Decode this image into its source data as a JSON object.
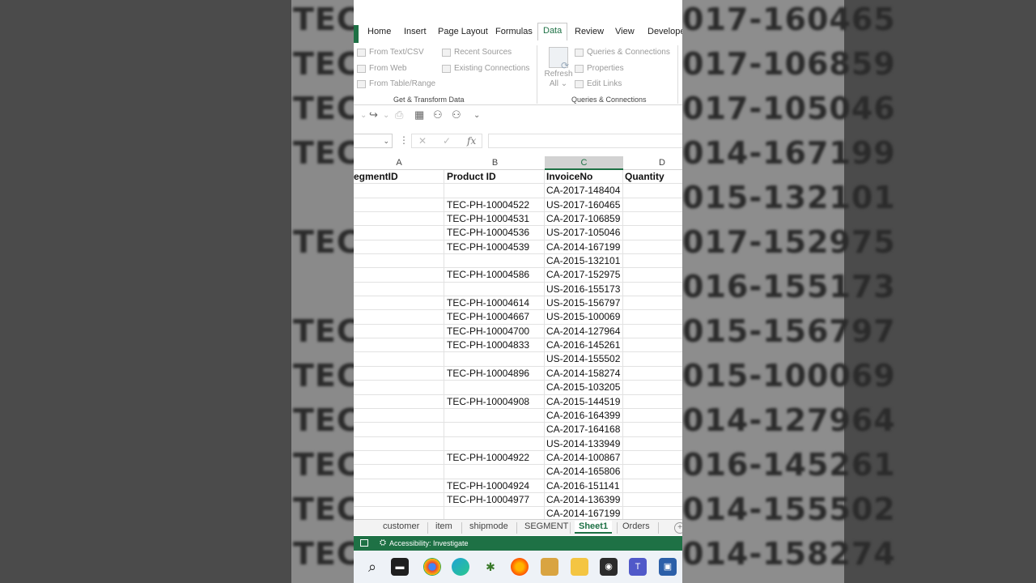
{
  "background": {
    "left_texts": [
      "TEC-",
      "TEC-",
      "TEC-",
      "TEC-",
      "TEC-",
      "TEC-",
      "TEC-",
      "TEC-",
      "TEC-",
      "TEC-",
      "TEC-"
    ],
    "right_texts": [
      "017-160465",
      "017-106859",
      "017-105046",
      "014-167199",
      "015-132101",
      "017-152975",
      "016-155173",
      "015-156797",
      "015-100069",
      "014-127964",
      "016-145261",
      "014-155502",
      "014-158274"
    ]
  },
  "ribbon": {
    "tabs": [
      "Home",
      "Insert",
      "Page Layout",
      "Formulas",
      "Data",
      "Review",
      "View",
      "Develope"
    ],
    "active_tab": "Data",
    "get_transform": {
      "items": [
        "From Text/CSV",
        "From Web",
        "From Table/Range",
        "Recent Sources",
        "Existing Connections"
      ],
      "label": "Get & Transform Data"
    },
    "refresh": {
      "line1": "Refresh",
      "line2": "All ⌄"
    },
    "queries": {
      "items": [
        "Queries & Connections",
        "Properties",
        "Edit Links"
      ],
      "label": "Queries & Connections"
    }
  },
  "qat": {
    "icons": [
      "redo-icon",
      "print-icon",
      "table-icon",
      "tree-icon",
      "hierarchy-icon",
      "more-icon"
    ]
  },
  "formula_bar": {
    "namebox": "⌄",
    "cancel": "✕",
    "enter": "✓",
    "fx": "fx",
    "value": ""
  },
  "grid": {
    "columns": [
      "A",
      "B",
      "C",
      "D"
    ],
    "selected_column": "C",
    "headers": [
      "egmentID",
      "Product ID",
      "InvoiceNo",
      "Quantity"
    ],
    "rows": [
      [
        "",
        "",
        "CA-2017-148404",
        ""
      ],
      [
        "",
        "TEC-PH-10004522",
        "US-2017-160465",
        ""
      ],
      [
        "",
        "TEC-PH-10004531",
        "CA-2017-106859",
        ""
      ],
      [
        "",
        "TEC-PH-10004536",
        "US-2017-105046",
        ""
      ],
      [
        "",
        "TEC-PH-10004539",
        "CA-2014-167199",
        ""
      ],
      [
        "",
        "",
        "CA-2015-132101",
        ""
      ],
      [
        "",
        "TEC-PH-10004586",
        "CA-2017-152975",
        ""
      ],
      [
        "",
        "",
        "US-2016-155173",
        ""
      ],
      [
        "",
        "TEC-PH-10004614",
        "US-2015-156797",
        ""
      ],
      [
        "",
        "TEC-PH-10004667",
        "US-2015-100069",
        ""
      ],
      [
        "",
        "TEC-PH-10004700",
        "CA-2014-127964",
        ""
      ],
      [
        "",
        "TEC-PH-10004833",
        "CA-2016-145261",
        ""
      ],
      [
        "",
        "",
        "US-2014-155502",
        ""
      ],
      [
        "",
        "TEC-PH-10004896",
        "CA-2014-158274",
        ""
      ],
      [
        "",
        "",
        "CA-2015-103205",
        ""
      ],
      [
        "",
        "TEC-PH-10004908",
        "CA-2015-144519",
        ""
      ],
      [
        "",
        "",
        "CA-2016-164399",
        ""
      ],
      [
        "",
        "",
        "CA-2017-164168",
        ""
      ],
      [
        "",
        "",
        "US-2014-133949",
        ""
      ],
      [
        "",
        "TEC-PH-10004922",
        "CA-2014-100867",
        ""
      ],
      [
        "",
        "",
        "CA-2014-165806",
        ""
      ],
      [
        "",
        "TEC-PH-10004924",
        "CA-2016-151141",
        ""
      ],
      [
        "",
        "TEC-PH-10004977",
        "CA-2014-136399",
        ""
      ],
      [
        "",
        "",
        "CA-2014-167199",
        ""
      ]
    ]
  },
  "sheet_tabs": {
    "tabs": [
      "customer",
      "item",
      "shipmode",
      "SEGMENT",
      "Sheet1",
      "Orders"
    ],
    "active": "Sheet1"
  },
  "status_bar": {
    "accessibility": "Accessibility: Investigate"
  },
  "taskbar": {
    "icons": [
      "search-icon",
      "file-explorer-black-icon",
      "chrome-icon",
      "edge-icon",
      "game-icon",
      "firefox-icon",
      "store-icon",
      "folder-icon",
      "camera-icon",
      "teams-icon",
      "terminal-icon"
    ]
  },
  "colors": {
    "excel_green": "#1e7145"
  }
}
